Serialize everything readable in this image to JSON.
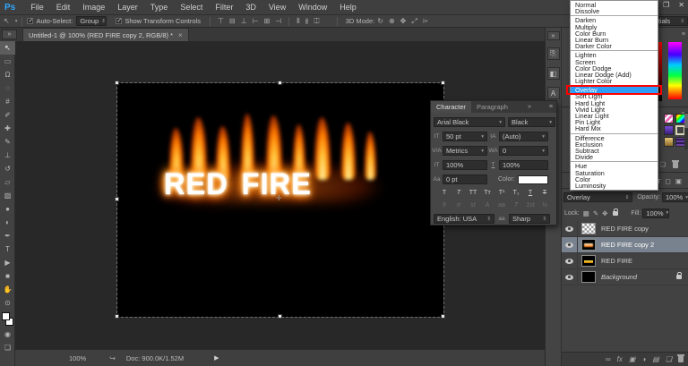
{
  "app": {
    "logo": "Ps"
  },
  "menubar": {
    "items": [
      "File",
      "Edit",
      "Image",
      "Layer",
      "Type",
      "Select",
      "Filter",
      "3D",
      "View",
      "Window",
      "Help"
    ],
    "window_buttons": [
      {
        "name": "minimize-button",
        "glyph": "–"
      },
      {
        "name": "restore-button",
        "glyph": "❐"
      },
      {
        "name": "close-button",
        "glyph": "✕"
      }
    ]
  },
  "options_bar": {
    "tool_icon_glyph": "↖",
    "auto_select_label": "Auto-Select:",
    "group_value": "Group",
    "show_transform_label": "Show Transform Controls",
    "align_icons": [
      {
        "name": "align-top-edges-icon",
        "glyph": "⊤"
      },
      {
        "name": "align-vertical-centers-icon",
        "glyph": "⊟"
      },
      {
        "name": "align-bottom-edges-icon",
        "glyph": "⊥"
      },
      {
        "name": "align-left-edges-icon",
        "glyph": "⊢"
      },
      {
        "name": "align-horizontal-centers-icon",
        "glyph": "⊞"
      },
      {
        "name": "align-right-edges-icon",
        "glyph": "⊣"
      }
    ],
    "distribute_icons": [
      {
        "name": "distribute-top-icon",
        "glyph": "⫴"
      },
      {
        "name": "distribute-center-icon",
        "glyph": "⫵"
      },
      {
        "name": "distribute-bottom-icon",
        "glyph": "⎅"
      }
    ],
    "mode_3d_label": "3D Mode:",
    "mode_3d_icons": [
      {
        "name": "3d-orbit-icon",
        "glyph": "↻"
      },
      {
        "name": "3d-roll-icon",
        "glyph": "⊕"
      },
      {
        "name": "3d-pan-icon",
        "glyph": "✥"
      },
      {
        "name": "3d-slide-icon",
        "glyph": "⤢"
      },
      {
        "name": "3d-zoom-icon",
        "glyph": "⌲"
      }
    ],
    "workspace": "Essentials"
  },
  "document_tab": {
    "title": "Untitled-1 @ 100% (RED FIRE copy 2, RGB/8) *",
    "close_glyph": "×"
  },
  "toolbar": {
    "tools": [
      {
        "name": "move-tool",
        "glyph": "↖",
        "selected": true
      },
      {
        "name": "marquee-tool",
        "glyph": "▭",
        "selected": false
      },
      {
        "name": "lasso-tool",
        "glyph": "Ω",
        "selected": false
      },
      {
        "name": "quick-selection-tool",
        "glyph": "◌",
        "selected": false
      },
      {
        "name": "crop-tool",
        "glyph": "#",
        "selected": false
      },
      {
        "name": "eyedropper-tool",
        "glyph": "✐",
        "selected": false
      },
      {
        "name": "healing-brush-tool",
        "glyph": "✚",
        "selected": false
      },
      {
        "name": "brush-tool",
        "glyph": "✎",
        "selected": false
      },
      {
        "name": "clone-stamp-tool",
        "glyph": "⊥",
        "selected": false
      },
      {
        "name": "history-brush-tool",
        "glyph": "↺",
        "selected": false
      },
      {
        "name": "eraser-tool",
        "glyph": "▱",
        "selected": false
      },
      {
        "name": "gradient-tool",
        "glyph": "▧",
        "selected": false
      },
      {
        "name": "blur-tool",
        "glyph": "●",
        "selected": false
      },
      {
        "name": "dodge-tool",
        "glyph": "◐",
        "selected": false
      },
      {
        "name": "pen-tool",
        "glyph": "✒",
        "selected": false
      },
      {
        "name": "type-tool",
        "glyph": "T",
        "selected": false
      },
      {
        "name": "path-selection-tool",
        "glyph": "▶",
        "selected": false
      },
      {
        "name": "shape-tool",
        "glyph": "■",
        "selected": false
      },
      {
        "name": "hand-tool",
        "glyph": "✋",
        "selected": false
      },
      {
        "name": "zoom-tool",
        "glyph": "⊙",
        "selected": false
      }
    ],
    "quick_mask_glyph": "◉",
    "screen_mode_glyph": "❏"
  },
  "canvas": {
    "text": "RED FIRE"
  },
  "character_panel": {
    "tab_character": "Character",
    "tab_paragraph": "Paragraph",
    "font_family": "Arial Black",
    "font_style": "Black",
    "size_icon": "tT",
    "size_value": "50 pt",
    "leading_icon": "tA",
    "leading_value": "(Auto)",
    "kerning_icon": "V/A",
    "kerning_value": "Metrics",
    "tracking_icon": "WA",
    "tracking_value": "0",
    "vscale_icon": "IT",
    "vscale_value": "100%",
    "hscale_icon": "T",
    "hscale_value": "100%",
    "baseline_icon": "Aa",
    "baseline_value": "0 pt",
    "color_label": "Color:",
    "style_buttons": [
      {
        "name": "faux-bold-button",
        "glyph": "T",
        "cls": ""
      },
      {
        "name": "faux-italic-button",
        "glyph": "T",
        "cls": "i"
      },
      {
        "name": "all-caps-button",
        "glyph": "TT",
        "cls": ""
      },
      {
        "name": "small-caps-button",
        "glyph": "Tᴛ",
        "cls": ""
      },
      {
        "name": "superscript-button",
        "glyph": "T¹",
        "cls": ""
      },
      {
        "name": "subscript-button",
        "glyph": "T₁",
        "cls": ""
      },
      {
        "name": "underline-button",
        "glyph": "T",
        "cls": "u"
      },
      {
        "name": "strikethrough-button",
        "glyph": "T",
        "cls": "s"
      }
    ],
    "opentype_buttons": [
      {
        "name": "ligatures-button",
        "glyph": "fi"
      },
      {
        "name": "contextual-alternates-button",
        "glyph": "σ"
      },
      {
        "name": "discretionary-ligatures-button",
        "glyph": "st"
      },
      {
        "name": "swash-button",
        "glyph": "A"
      },
      {
        "name": "stylistic-alternates-button",
        "glyph": "aa"
      },
      {
        "name": "titling-alternates-button",
        "glyph": "T"
      },
      {
        "name": "ordinals-button",
        "glyph": "1st"
      },
      {
        "name": "fractions-button",
        "glyph": "½"
      }
    ],
    "language_value": "English: USA",
    "antialias_icon": "aa",
    "antialias_value": "Sharp"
  },
  "blend_menu": {
    "groups": [
      [
        "Normal",
        "Dissolve"
      ],
      [
        "Darken",
        "Multiply",
        "Color Burn",
        "Linear Burn",
        "Darker Color"
      ],
      [
        "Lighten",
        "Screen",
        "Color Dodge",
        "Linear Dodge (Add)",
        "Lighter Color"
      ],
      [
        "Overlay",
        "Soft Light",
        "Hard Light",
        "Vivid Light",
        "Linear Light",
        "Pin Light",
        "Hard Mix"
      ],
      [
        "Difference",
        "Exclusion",
        "Subtract",
        "Divide"
      ],
      [
        "Hue",
        "Saturation",
        "Color",
        "Luminosity"
      ]
    ],
    "selected": "Overlay",
    "highlight_color": "#2e9df7",
    "annotation_color": "#ff0000"
  },
  "right_dock": {
    "collapse_glyph": "«",
    "strip_icons": [
      {
        "name": "history-panel-icon",
        "glyph": "⎘"
      },
      {
        "name": "properties-panel-icon",
        "glyph": "◧"
      },
      {
        "name": "character-panel-icon",
        "glyph": "A"
      }
    ],
    "styles_chips": [
      "pink",
      "rainbow",
      "purple",
      "frame",
      "gold",
      "violet"
    ]
  },
  "layers_panel": {
    "filter_icons": [
      {
        "name": "type-filter-icon",
        "glyph": "T"
      },
      {
        "name": "shape-filter-icon",
        "glyph": "◻"
      },
      {
        "name": "smart-object-filter-icon",
        "glyph": "▣"
      }
    ],
    "blend_mode": "Overlay",
    "opacity_label": "Opacity:",
    "opacity_value": "100%",
    "lock_label": "Lock:",
    "lock_icons": [
      {
        "name": "lock-transparent-pixels-icon",
        "glyph": "▦"
      },
      {
        "name": "lock-image-pixels-icon",
        "glyph": "✎"
      },
      {
        "name": "lock-position-icon",
        "glyph": "✥"
      },
      {
        "name": "lock-all-icon",
        "glyph": "lock"
      }
    ],
    "fill_label": "Fill:",
    "fill_value": "100%",
    "layers": [
      {
        "name": "RED FIRE copy",
        "thumb": "checker",
        "selected": false,
        "locked": false,
        "italic": false
      },
      {
        "name": "RED FIRE copy 2",
        "thumb": "fire",
        "selected": true,
        "locked": false,
        "italic": false
      },
      {
        "name": "RED FIRE",
        "thumb": "fire2",
        "selected": false,
        "locked": false,
        "italic": false
      },
      {
        "name": "Background",
        "thumb": "black",
        "selected": false,
        "locked": true,
        "italic": true
      }
    ],
    "bottom_icons": [
      {
        "name": "link-layers-icon",
        "glyph": "∞"
      },
      {
        "name": "layer-style-icon",
        "glyph": "fx"
      },
      {
        "name": "layer-mask-icon",
        "glyph": "▣"
      },
      {
        "name": "adjustment-layer-icon",
        "glyph": "◑"
      },
      {
        "name": "layer-group-icon",
        "glyph": "▤"
      },
      {
        "name": "new-layer-icon",
        "glyph": "❏"
      },
      {
        "name": "delete-layer-icon",
        "glyph": "trash"
      }
    ]
  },
  "status_bar": {
    "zoom_value": "100%",
    "export_icon": "↪",
    "doc_info": "Doc: 900.0K/1.52M",
    "arrow_glyph": "▶"
  }
}
